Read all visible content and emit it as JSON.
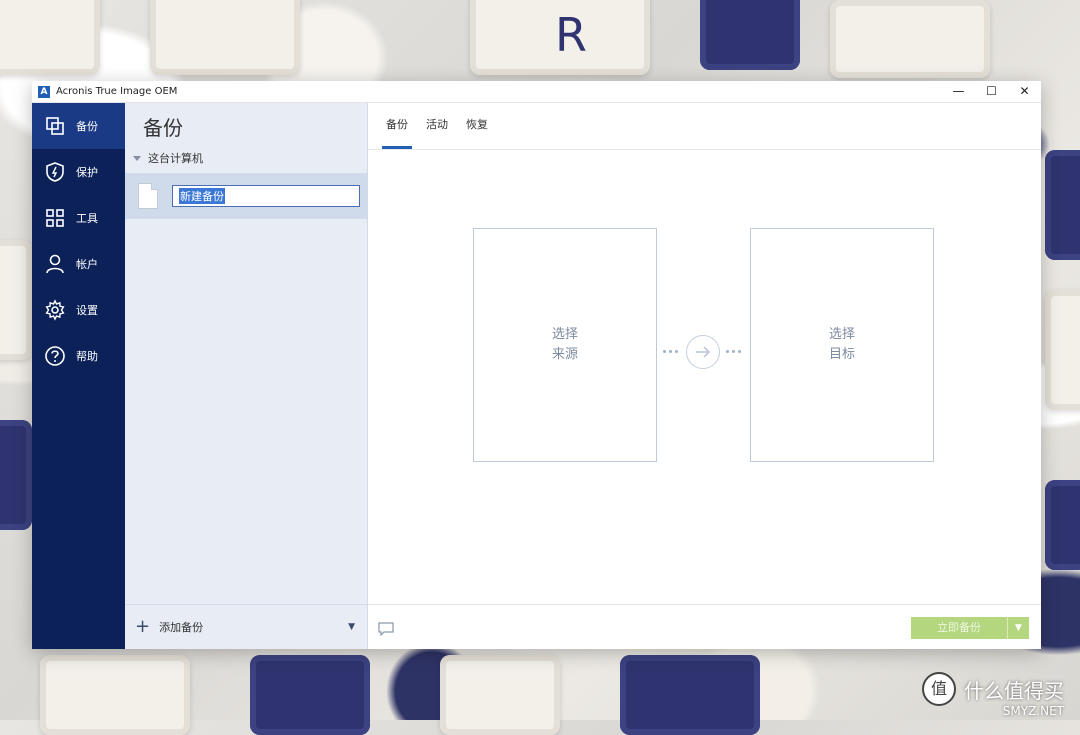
{
  "window": {
    "title": "Acronis True Image OEM",
    "logo_letter": "A",
    "minimize": "—",
    "maximize": "☐",
    "close": "✕"
  },
  "sidebar": {
    "items": [
      {
        "label": "备份",
        "icon": "backup-icon",
        "active": true
      },
      {
        "label": "保护",
        "icon": "shield-icon"
      },
      {
        "label": "工具",
        "icon": "tools-grid-icon"
      },
      {
        "label": "帐户",
        "icon": "account-icon"
      },
      {
        "label": "设置",
        "icon": "gear-icon"
      },
      {
        "label": "帮助",
        "icon": "help-icon"
      }
    ]
  },
  "list": {
    "title": "备份",
    "group_label": "这台计算机",
    "item_name": "新建备份",
    "add_label": "添加备份"
  },
  "main": {
    "tabs": [
      "备份",
      "活动",
      "恢复"
    ],
    "source_box": {
      "line1": "选择",
      "line2": "来源"
    },
    "target_box": {
      "line1": "选择",
      "line2": "目标"
    },
    "backup_now": "立即备份"
  },
  "watermark": {
    "logo": "值",
    "text": "什么值得买",
    "sub": "SMYZ.NET"
  },
  "colors": {
    "sidebar": "#0b2158",
    "sidebar_active": "#1a3a86",
    "accent": "#1f5fb4",
    "button": "#b3d67e"
  }
}
